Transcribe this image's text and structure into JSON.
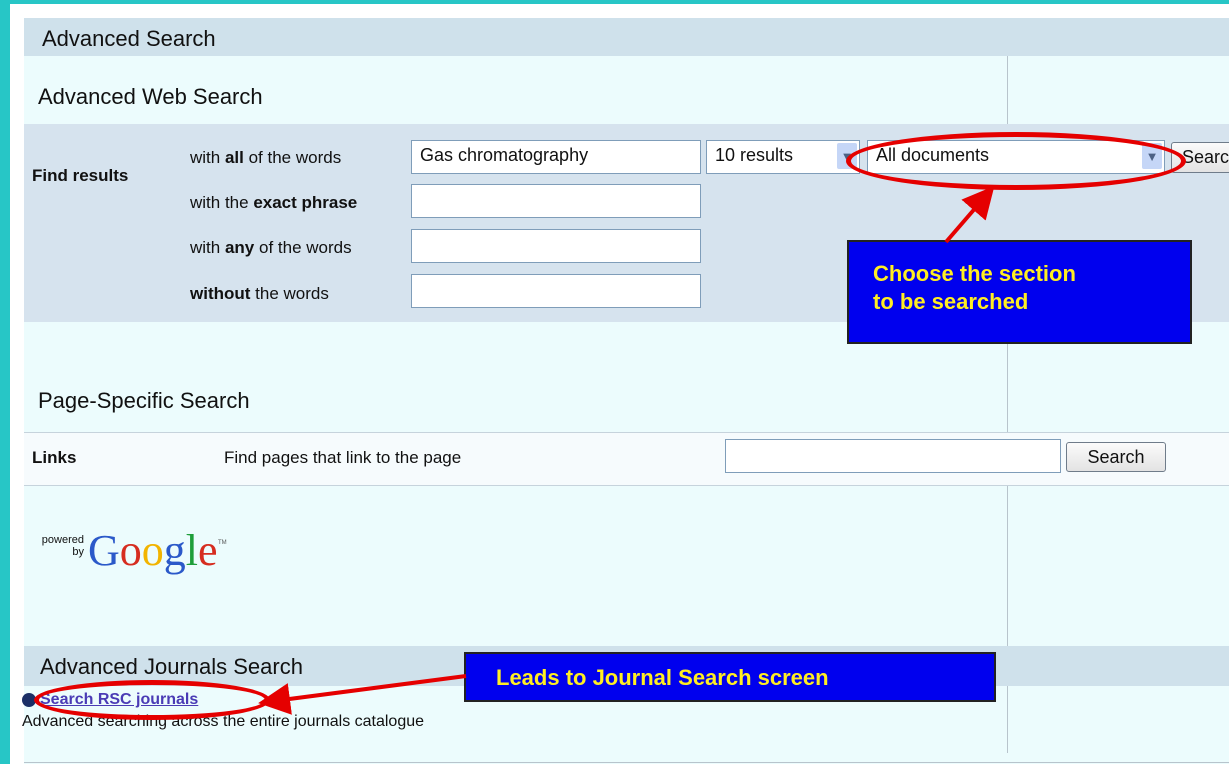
{
  "page": {
    "title": "Advanced Search"
  },
  "web_search": {
    "heading": "Advanced Web Search",
    "find_results_label": "Find results",
    "rows": [
      {
        "pre": "with ",
        "bold": "all",
        "post": " of the words",
        "value": "Gas chromatography"
      },
      {
        "pre": "with the ",
        "bold": "exact phrase",
        "post": "",
        "value": ""
      },
      {
        "pre": "with ",
        "bold": "any",
        "post": " of the words",
        "value": ""
      },
      {
        "pre": "",
        "bold": "without",
        "post": " the words",
        "value": ""
      }
    ],
    "results_select": "10 results",
    "section_select": "All documents",
    "search_button": "Search"
  },
  "callouts": {
    "section_line1": "Choose the section",
    "section_line2": "to be searched",
    "journal": "Leads to Journal Search screen"
  },
  "page_specific": {
    "heading": "Page-Specific Search",
    "links_label": "Links",
    "links_desc": "Find pages that link to the page",
    "links_value": "",
    "search_button": "Search"
  },
  "powered": {
    "line1": "powered",
    "line2": "by",
    "brand": "Google",
    "tm": "TM"
  },
  "journals": {
    "heading": "Advanced Journals Search",
    "link": "Search RSC journals",
    "description": "Advanced searching across the entire journals catalogue"
  },
  "colors": {
    "accent_border": "#27c6c6",
    "annotation_red": "#e50000",
    "callout_bg": "#0000ee",
    "callout_text": "#ffee22"
  }
}
